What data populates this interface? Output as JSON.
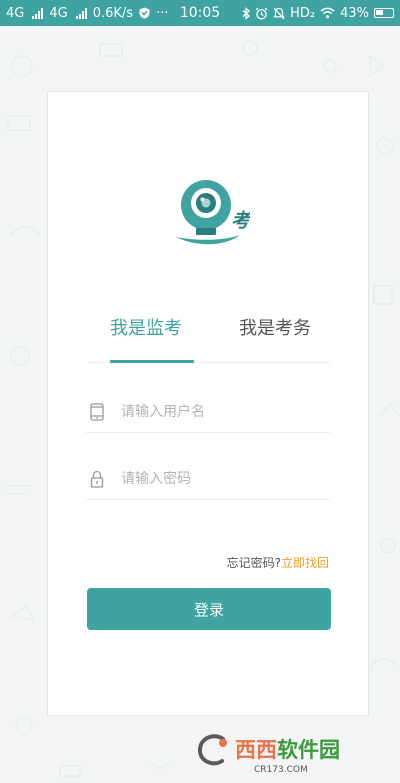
{
  "status_bar": {
    "net1": "4G",
    "net2": "4G",
    "speed": "0.6K/s",
    "dots": "···",
    "time": "10:05",
    "hd": "HD₂",
    "battery": "43%"
  },
  "tabs": [
    {
      "label": "我是监考",
      "active": true
    },
    {
      "label": "我是考务",
      "active": false
    }
  ],
  "username": {
    "placeholder": "请输入用户名",
    "value": ""
  },
  "password": {
    "placeholder": "请输入密码",
    "value": ""
  },
  "forgot": {
    "prefix": "忘记密码?",
    "link": "立即找回"
  },
  "login_button": "登录",
  "logo": {
    "glyph": "考"
  },
  "watermark": {
    "brand_left": "西西",
    "brand_right": "软件园",
    "url": "CR173.COM"
  },
  "colors": {
    "primary": "#3fa3a1",
    "accent": "#f0a020"
  }
}
